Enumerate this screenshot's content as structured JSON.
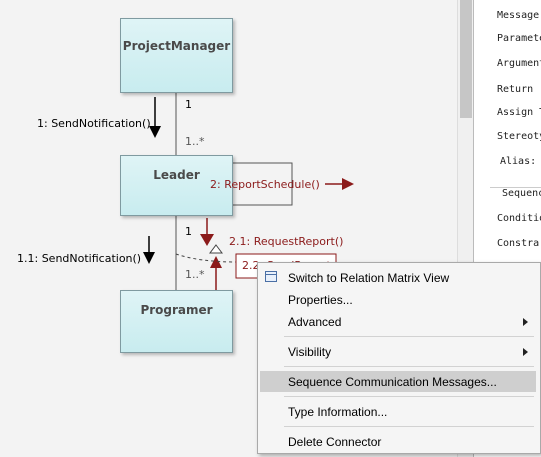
{
  "diagram": {
    "nodes": {
      "project_manager": "ProjectManager",
      "leader": "Leader",
      "programer": "Programer"
    },
    "multiplicity": {
      "pm_leader_top": "1",
      "pm_leader_bottom": "1..*",
      "leader_prog_top": "1",
      "leader_prog_bottom": "1..*"
    },
    "messages": {
      "m1": "1: SendNotification()",
      "m11": "1.1: SendNotification()",
      "m2": "2: ReportSchedule()",
      "m21": "2.1: RequestReport()",
      "m22": "2.2: SendReport()"
    }
  },
  "properties_panel": {
    "labels": [
      "Message",
      "Paramete",
      "Argument",
      "Return",
      "Assign T",
      "Stereoty",
      "Alias:"
    ],
    "section_title": "Sequence",
    "section_labels": [
      "Conditio",
      "Constra"
    ]
  },
  "context_menu": {
    "items": [
      {
        "label": "Switch to Relation Matrix View",
        "icon": "matrix-view-icon"
      },
      {
        "label": "Properties..."
      },
      {
        "label": "Advanced",
        "submenu": true
      },
      {
        "label": "Visibility",
        "submenu": true
      },
      {
        "label": "Sequence Communication Messages...",
        "highlighted": true
      },
      {
        "label": "Type Information..."
      },
      {
        "label": "Delete Connector"
      }
    ]
  },
  "colors": {
    "message_red": "#8b1a1a",
    "node_fill": "#cdeef1",
    "highlight": "#cfcfcf"
  }
}
